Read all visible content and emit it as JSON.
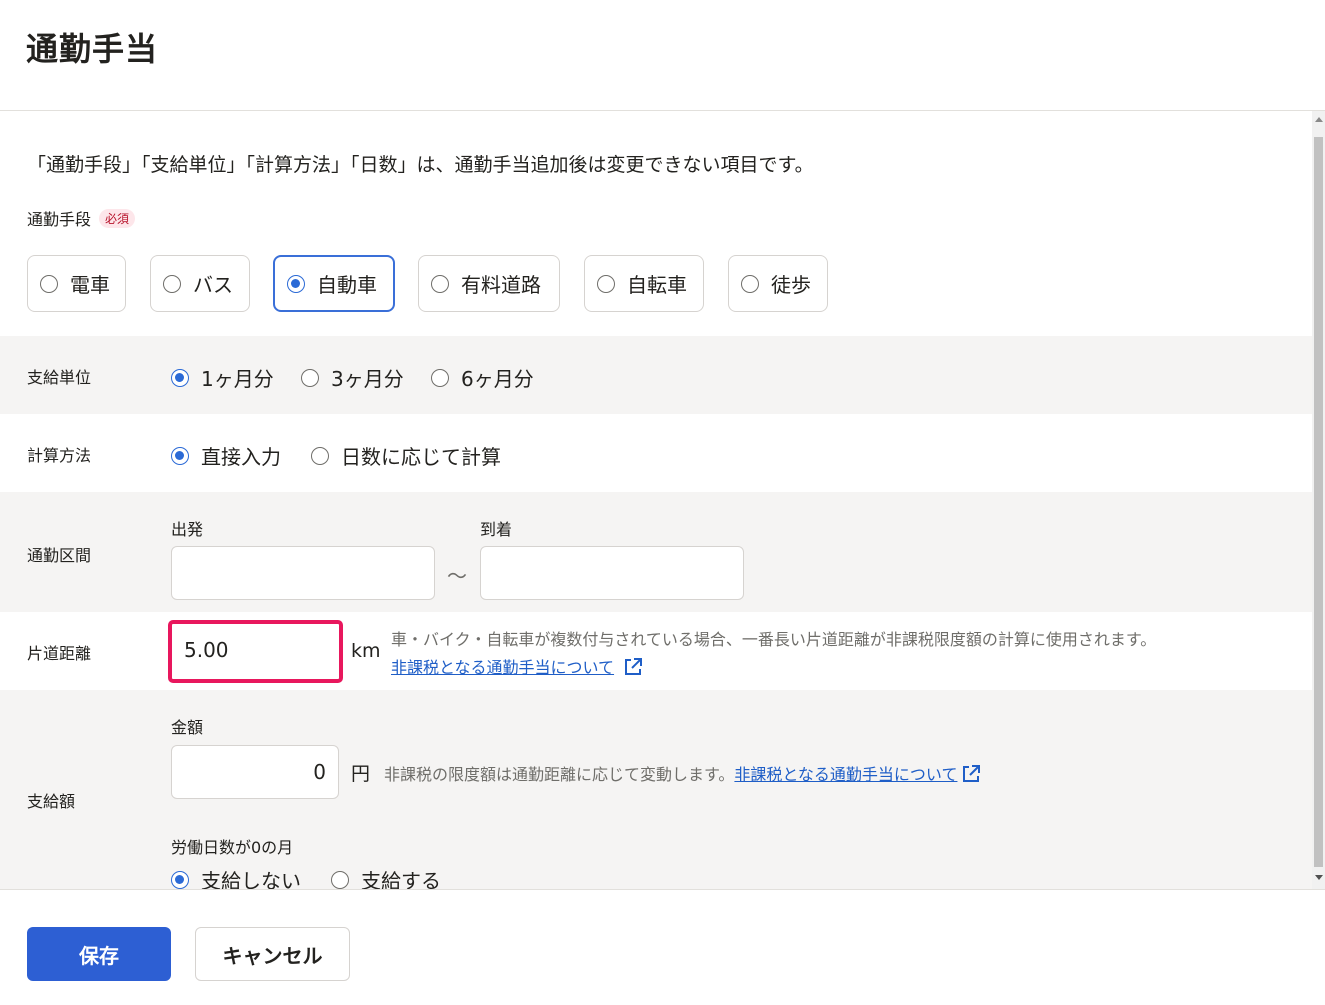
{
  "header": {
    "title": "通勤手当"
  },
  "notice": "「通勤手段」「支給単位」「計算方法」「日数」は、通勤手当追加後は変更できない項目です。",
  "commute_mode": {
    "label": "通勤手段",
    "required_badge": "必須",
    "options": [
      "電車",
      "バス",
      "自動車",
      "有料道路",
      "自転車",
      "徒歩"
    ],
    "selected": "自動車"
  },
  "payment_unit": {
    "label": "支給単位",
    "options": [
      "1ヶ月分",
      "3ヶ月分",
      "6ヶ月分"
    ],
    "selected": "1ヶ月分"
  },
  "calc_method": {
    "label": "計算方法",
    "options": [
      "直接入力",
      "日数に応じて計算"
    ],
    "selected": "直接入力"
  },
  "commute_section": {
    "label": "通勤区間",
    "departure_label": "出発",
    "arrival_label": "到着",
    "departure_value": "",
    "arrival_value": "",
    "separator": "～"
  },
  "one_way_distance": {
    "label": "片道距離",
    "value": "5.00",
    "unit": "km",
    "help": "車・バイク・自転車が複数付与されている場合、一番長い片道距離が非課税限度額の計算に使用されます。",
    "link": "非課税となる通勤手当について"
  },
  "payment_amount": {
    "label": "支給額",
    "amount_label": "金額",
    "value": "0",
    "unit": "円",
    "help": "非課税の限度額は通勤距離に応じて変動します。",
    "link": "非課税となる通勤手当について",
    "zero_days_label": "労働日数が0の月",
    "zero_days_options": [
      "支給しない",
      "支給する"
    ],
    "zero_days_selected": "支給しない"
  },
  "footer": {
    "save": "保存",
    "cancel": "キャンセル"
  },
  "colors": {
    "accent": "#2d5fd3",
    "highlight": "#e8175d",
    "link": "#1f5ec7"
  }
}
